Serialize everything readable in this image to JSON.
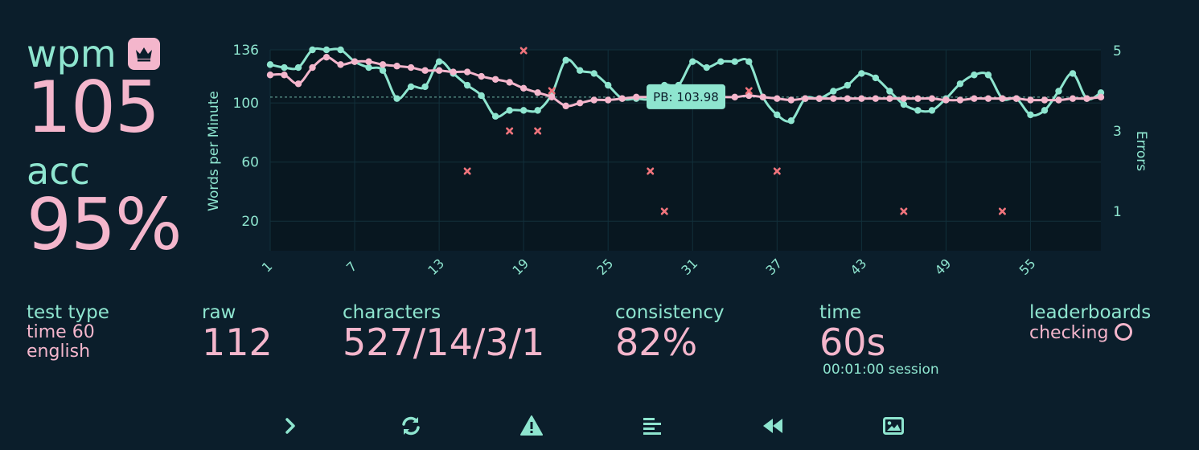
{
  "colors": {
    "background": "#0b1e2b",
    "accent_mint": "#8ee5cf",
    "accent_pink": "#f4b6cc",
    "error_red": "#f0747c"
  },
  "summary": {
    "wpm_label": "wpm",
    "wpm_value": "105",
    "acc_label": "acc",
    "acc_value": "95%",
    "personal_best_icon": "crown-icon"
  },
  "stats": {
    "test_type": {
      "label": "test type",
      "lines": [
        "time 60",
        "english"
      ]
    },
    "raw": {
      "label": "raw",
      "value": "112"
    },
    "characters": {
      "label": "characters",
      "value": "527/14/3/1"
    },
    "consistency": {
      "label": "consistency",
      "value": "82%"
    },
    "time": {
      "label": "time",
      "value": "60s",
      "session": "00:01:00 session"
    },
    "leaderboards": {
      "label": "leaderboards",
      "status": "checking"
    }
  },
  "toolbar": [
    {
      "name": "next-test-button",
      "icon": "chevron-right-icon"
    },
    {
      "name": "restart-test-button",
      "icon": "sync-icon"
    },
    {
      "name": "report-button",
      "icon": "warning-icon"
    },
    {
      "name": "words-history-button",
      "icon": "align-left-icon"
    },
    {
      "name": "replay-button",
      "icon": "rewind-icon"
    },
    {
      "name": "save-screenshot-button",
      "icon": "image-icon"
    }
  ],
  "chart_data": {
    "type": "line",
    "xlabel": "",
    "ylabel": "Words per Minute",
    "y2label": "Errors",
    "x": [
      1,
      2,
      3,
      4,
      5,
      6,
      7,
      8,
      9,
      10,
      11,
      12,
      13,
      14,
      15,
      16,
      17,
      18,
      19,
      20,
      21,
      22,
      23,
      24,
      25,
      26,
      27,
      28,
      29,
      30,
      31,
      32,
      33,
      34,
      35,
      36,
      37,
      38,
      39,
      40,
      41,
      42,
      43,
      44,
      45,
      46,
      47,
      48,
      49,
      50,
      51,
      52,
      53,
      54,
      55,
      56,
      57,
      58,
      59,
      60
    ],
    "x_ticks": [
      1,
      7,
      13,
      19,
      25,
      31,
      37,
      43,
      49,
      55
    ],
    "y_ticks": [
      20,
      60,
      100,
      136
    ],
    "ylim": [
      0,
      136
    ],
    "y2_ticks": [
      1,
      3,
      5
    ],
    "y2lim": [
      0,
      5
    ],
    "grid": true,
    "pb_line": {
      "value": 103.98,
      "label": "PB: 103.98"
    },
    "series": [
      {
        "name": "raw",
        "color": "#8ee5cf",
        "values": [
          126,
          124,
          124,
          136,
          136,
          136,
          128,
          124,
          122,
          103,
          111,
          111,
          128,
          120,
          112,
          105,
          91,
          95,
          95,
          95,
          106,
          129,
          122,
          120,
          112,
          103,
          103,
          103,
          112,
          112,
          128,
          124,
          128,
          128,
          128,
          104,
          92,
          88,
          103,
          103,
          108,
          112,
          120,
          117,
          108,
          99,
          95,
          95,
          103,
          113,
          119,
          119,
          103,
          103,
          92,
          95,
          108,
          120,
          103,
          107
        ]
      },
      {
        "name": "wpm",
        "color": "#f4b6cc",
        "values": [
          119,
          119,
          113,
          124,
          131,
          126,
          128,
          128,
          126,
          125,
          124,
          122,
          122,
          121,
          121,
          118,
          116,
          114,
          110,
          107,
          104,
          98,
          100,
          102,
          102,
          103,
          104,
          104,
          104,
          103,
          103,
          103,
          104,
          104,
          105,
          104,
          103,
          102,
          103,
          103,
          103,
          103,
          103,
          103,
          103,
          103,
          103,
          103,
          102,
          102,
          103,
          103,
          103,
          103,
          102,
          102,
          102,
          103,
          103,
          104
        ]
      },
      {
        "name": "errors",
        "color": "#f0747c",
        "type": "scatter",
        "points": [
          [
            15,
            2
          ],
          [
            18,
            3
          ],
          [
            19,
            5
          ],
          [
            20,
            3
          ],
          [
            21,
            4
          ],
          [
            28,
            2
          ],
          [
            29,
            1
          ],
          [
            35,
            4
          ],
          [
            37,
            2
          ],
          [
            46,
            1
          ],
          [
            53,
            1
          ]
        ]
      }
    ]
  }
}
